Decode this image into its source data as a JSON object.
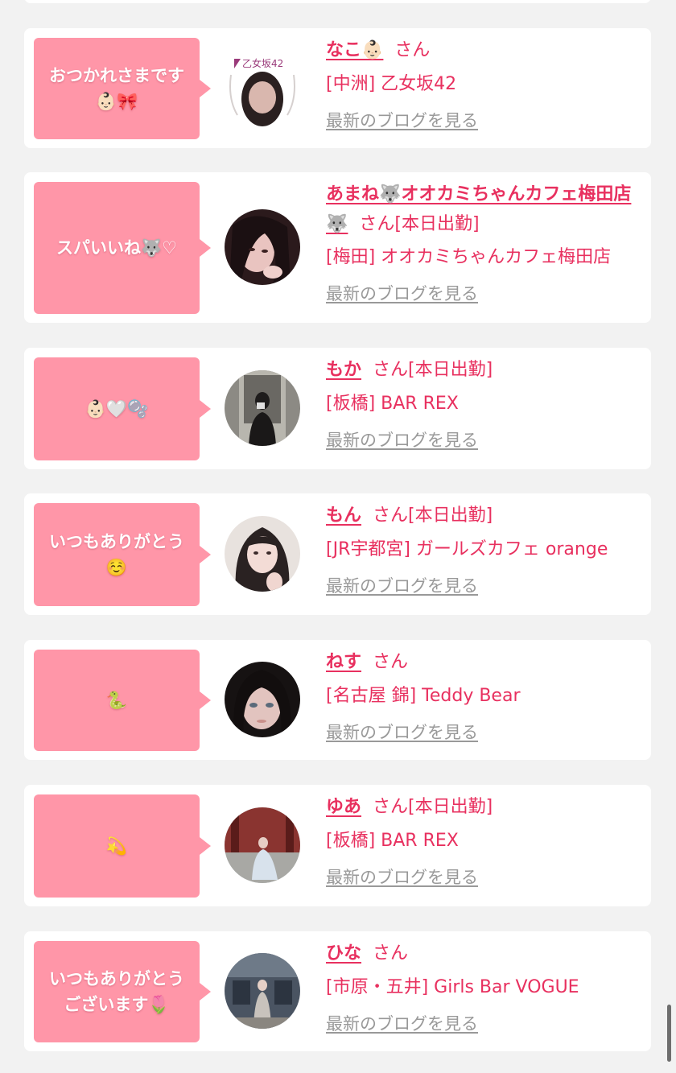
{
  "cards": [
    {
      "message": "おつかれさまです\n👶🏻🎀",
      "name": "なこ👶🏻",
      "honorific": "さん",
      "status": "",
      "store": "[中洲] 乙女坂42",
      "blog_link": "最新のブログを見る",
      "avatar_text": "乙女坂42"
    },
    {
      "message": "スパいいね🐺♡",
      "name": "あまね🐺オオカミちゃんカフェ梅田店🐺",
      "honorific": "さん",
      "status": "[本日出勤]",
      "store": "[梅田] オオカミちゃんカフェ梅田店",
      "blog_link": "最新のブログを見る"
    },
    {
      "message": "👶🏻🤍🫧",
      "name": "もか",
      "honorific": "さん",
      "status": "[本日出勤]",
      "store": "[板橋] BAR REX",
      "blog_link": "最新のブログを見る"
    },
    {
      "message": "いつもありがとう\n☺️",
      "name": "もん",
      "honorific": "さん",
      "status": "[本日出勤]",
      "store": "[JR宇都宮] ガールズカフェ orange",
      "blog_link": "最新のブログを見る"
    },
    {
      "message": "🐍",
      "name": "ねす",
      "honorific": "さん",
      "status": "",
      "store": "[名古屋 錦] Teddy Bear",
      "blog_link": "最新のブログを見る"
    },
    {
      "message": "💫",
      "name": "ゆあ",
      "honorific": "さん",
      "status": "[本日出勤]",
      "store": "[板橋] BAR REX",
      "blog_link": "最新のブログを見る"
    },
    {
      "message": "いつもありがとう\nございます🌷",
      "name": "ひな",
      "honorific": "さん",
      "status": "",
      "store": "[市原・五井] Girls Bar VOGUE",
      "blog_link": "最新のブログを見る"
    }
  ],
  "colors": {
    "bubble": "#ff96a8",
    "accent_text": "#e8305f",
    "muted_link": "#999999",
    "page_bg": "#f2f2f2"
  }
}
